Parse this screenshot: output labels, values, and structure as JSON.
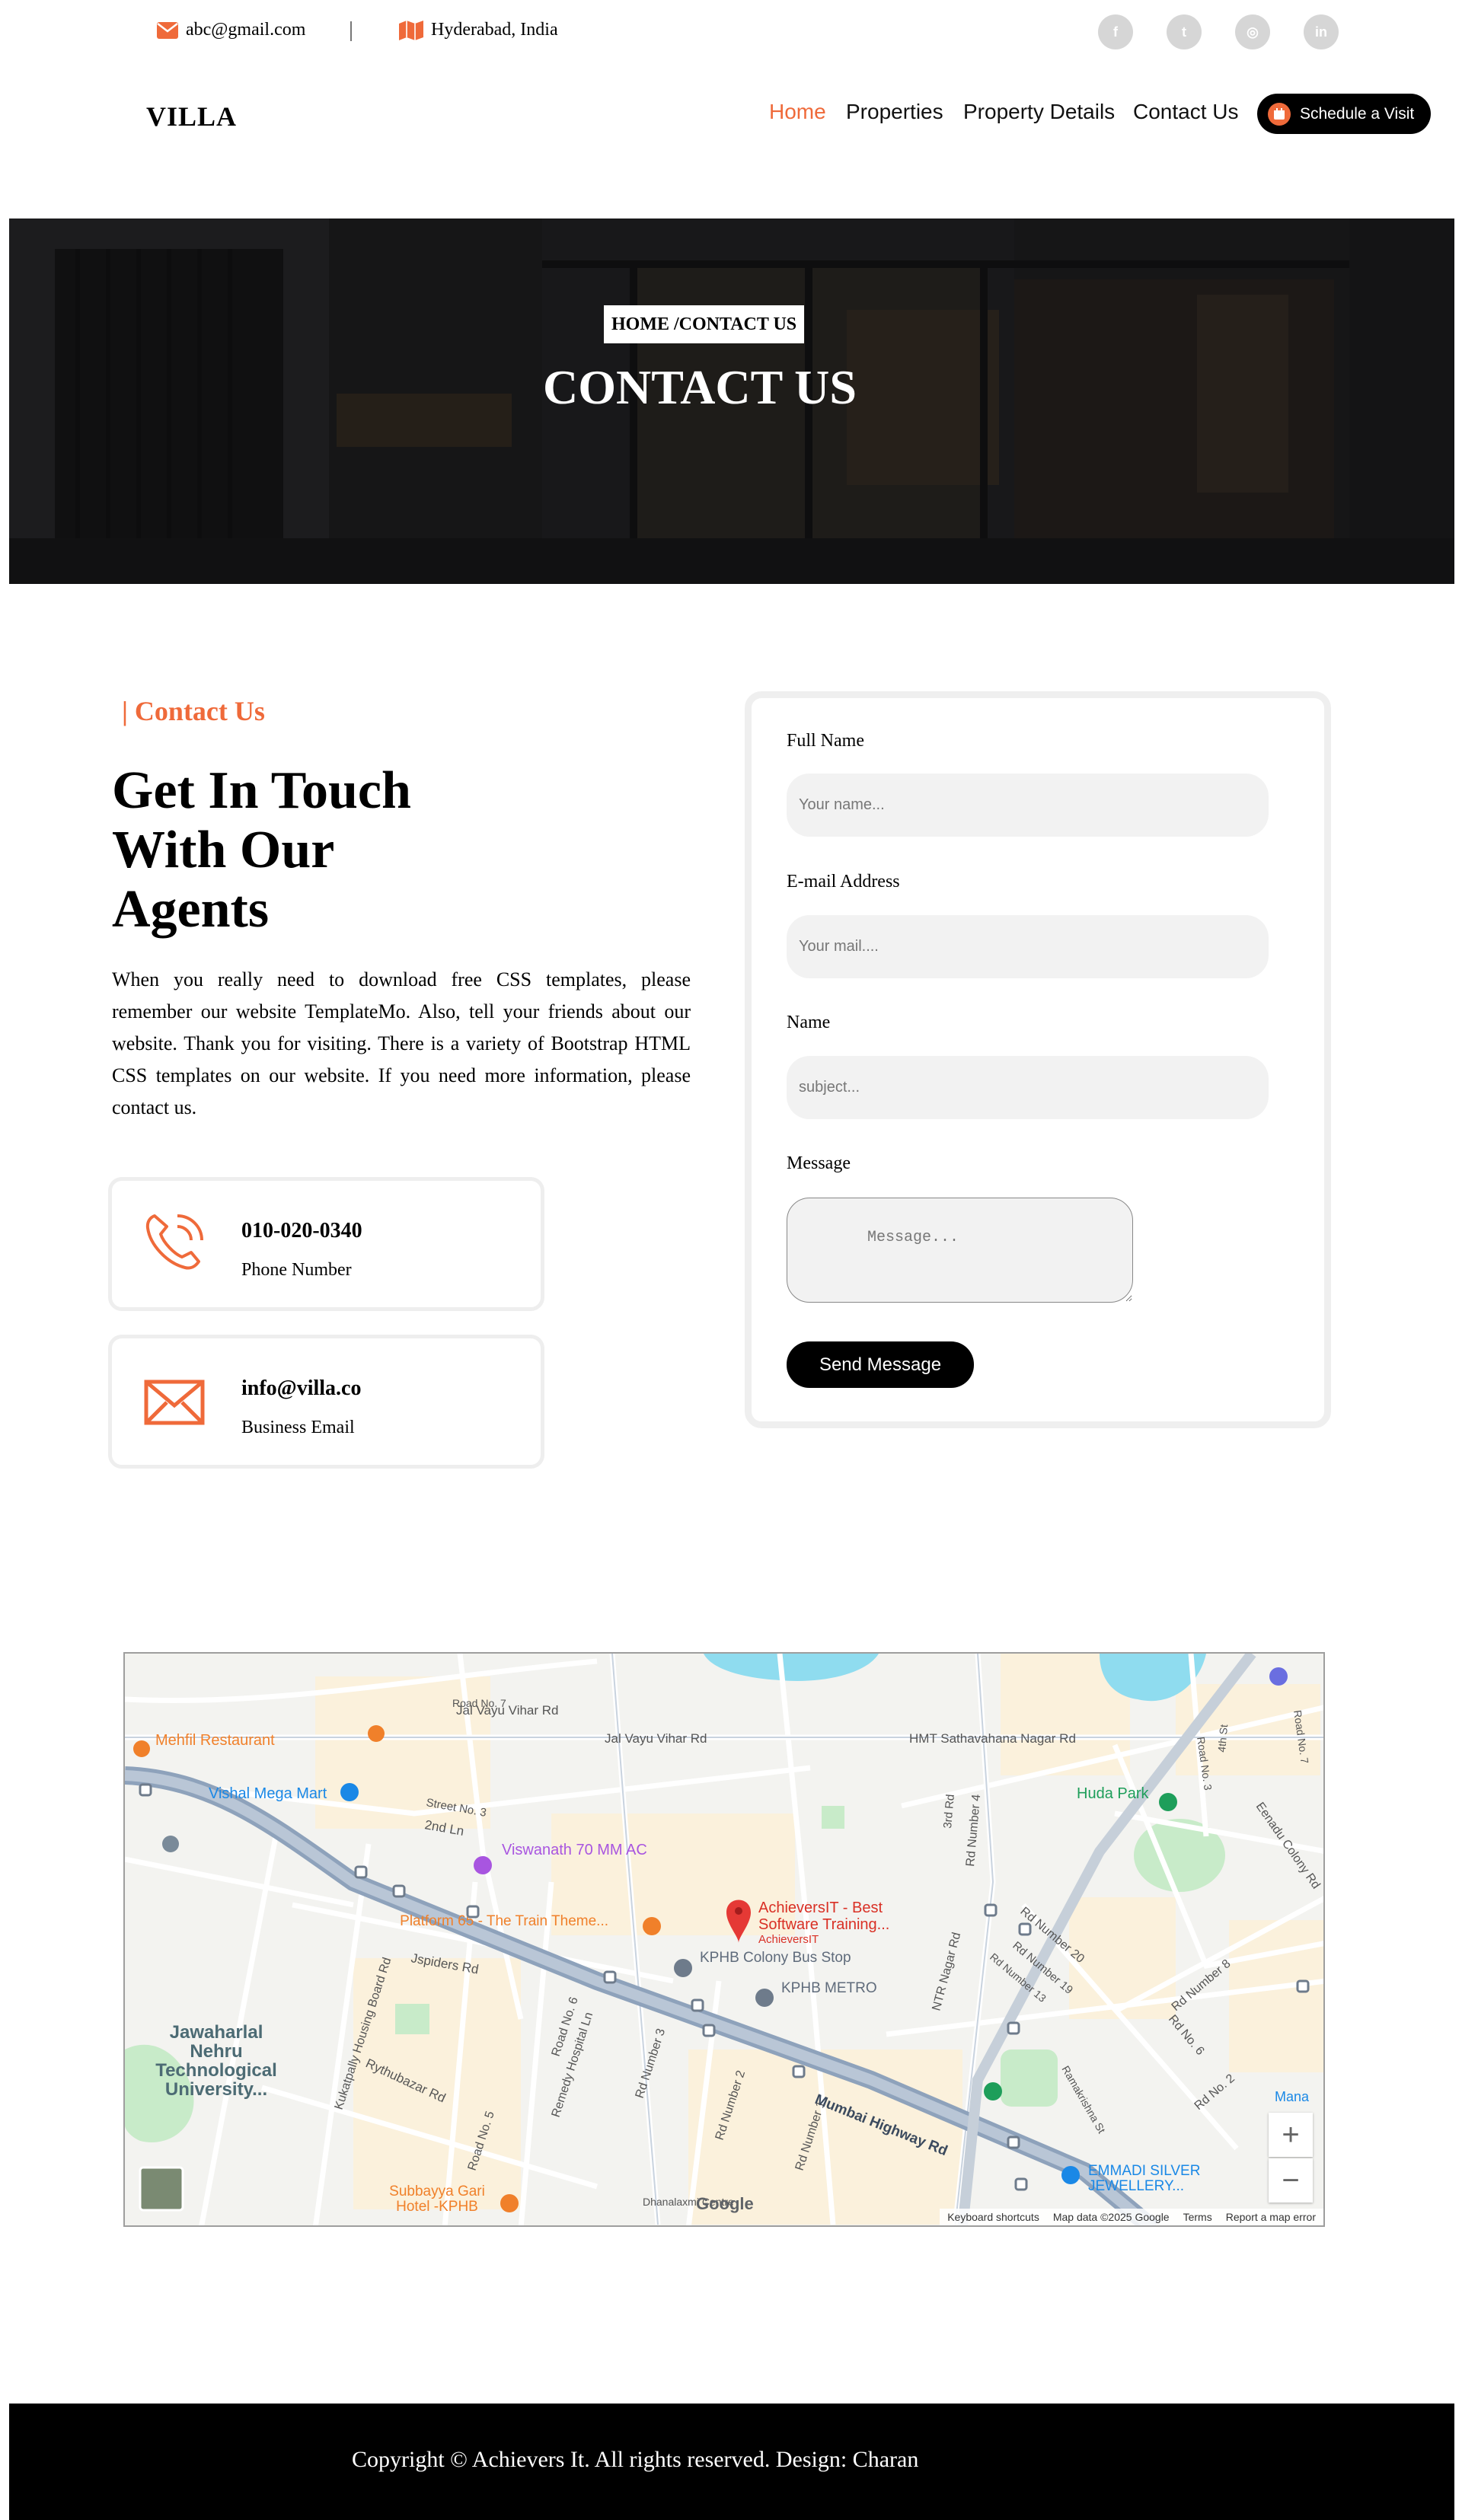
{
  "topbar": {
    "email": "abc@gmail.com",
    "location": "Hyderabad, India",
    "social_icons": [
      "facebook-icon",
      "twitter-icon",
      "instagram-icon",
      "linkedin-icon"
    ],
    "social_glyphs": [
      "f",
      "t",
      "◎",
      "in"
    ]
  },
  "nav": {
    "logo": "VILLA",
    "links": [
      {
        "label": "Home",
        "active": true
      },
      {
        "label": "Properties",
        "active": false
      },
      {
        "label": "Property Details",
        "active": false
      },
      {
        "label": "Contact Us",
        "active": false
      }
    ],
    "cta_label": "Schedule a Visit"
  },
  "hero": {
    "breadcrumb": "HOME /CONTACT US",
    "title": "CONTACT US"
  },
  "contact": {
    "eyebrow": "| Contact Us",
    "heading": "Get In Touch With Our Agents",
    "description": "When you really need to download free CSS templates, please remember our website TemplateMo. Also, tell your friends about our website. Thank you for visiting. There is a variety of Bootstrap HTML CSS templates on our website. If you need more information, please contact us.",
    "phone": {
      "value": "010-020-0340",
      "label": "Phone Number"
    },
    "email": {
      "value": "info@villa.co",
      "label": "Business Email"
    }
  },
  "form": {
    "full_name": {
      "label": "Full Name",
      "placeholder": "Your name..."
    },
    "email": {
      "label": "E-mail Address",
      "placeholder": "Your mail...."
    },
    "subject": {
      "label": "Name",
      "placeholder": "subject..."
    },
    "message": {
      "label": "Message",
      "placeholder": "Message..."
    },
    "submit_label": "Send Message"
  },
  "map": {
    "places": {
      "mehfil": "Mehfil Restaurant",
      "vishal": "Vishal Mega Mart",
      "viswanath": "Viswanath 70 MM AC",
      "platform": "Platform 65 - The Train Theme...",
      "achievers_line1": "AchieversIT - Best",
      "achievers_line2": "Software Training...",
      "achievers_sub": "AchieversIT",
      "kphb_bus": "KPHB Colony Bus Stop",
      "kphb_metro": "KPHB METRO",
      "huda": "Huda Park",
      "jntu_line1": "Jawaharlal",
      "jntu_line2": "Nehru",
      "jntu_line3": "Technological",
      "jntu_line4": "University...",
      "subbayya_line1": "Subbayya Gari",
      "subbayya_line2": "Hotel -KPHB",
      "emmadi_line1": "EMMADI SILVER",
      "emmadi_line2": "JEWELLERY...",
      "dhanalaxmi": "Dhanalaxmi Centre",
      "mana": "Mana"
    },
    "roads": {
      "jal1": "Jal Vayu Vihar Rd",
      "jal2": "Jal Vayu Vihar Rd",
      "hmt": "HMT Sathavahana Nagar Rd",
      "mumbai": "Mumbai Highway Rd",
      "jspiders": "Jspiders Rd",
      "rythu": "Rythubazar Rd",
      "kukatpally": "Kukatpally Housing Board Rd",
      "remedy": "Remedy Hospital Ln",
      "ntr": "NTR Nagar Rd",
      "second_ln": "2nd Ln",
      "road7": "Road No. 7",
      "street3": "Street No. 3",
      "road6": "Road No. 6",
      "road5": "Road No. 5",
      "rd3": "Rd Number 3",
      "rd2": "Rd Number 2",
      "rd1": "Rd Number 1",
      "rd4": "Rd Number 4",
      "rd20": "Rd Number 20",
      "rd19": "Rd Number 19",
      "rd13": "Rd Number 13",
      "rd8": "Rd Number 8",
      "rdno6": "Rd No. 6",
      "rdno2": "Rd No. 2",
      "rama": "Ramakrishna St",
      "eenadu": "Eenadu Colony Rd",
      "road3": "Road No. 3",
      "road7b": "Road No. 7",
      "third": "3rd Rd",
      "fourth": "4th St"
    },
    "footer": {
      "shortcuts": "Keyboard shortcuts",
      "data": "Map data ©2025 Google",
      "terms": "Terms",
      "report": "Report a map error"
    },
    "brand": "Google",
    "zoom_in": "+",
    "zoom_out": "−"
  },
  "footer": {
    "copyright": "Copyright © Achievers It. All rights reserved. Design: Charan"
  },
  "colors": {
    "accent": "#ef6a3a",
    "footer_bg": "#000000",
    "hero_overlay": "#1e1e20"
  }
}
